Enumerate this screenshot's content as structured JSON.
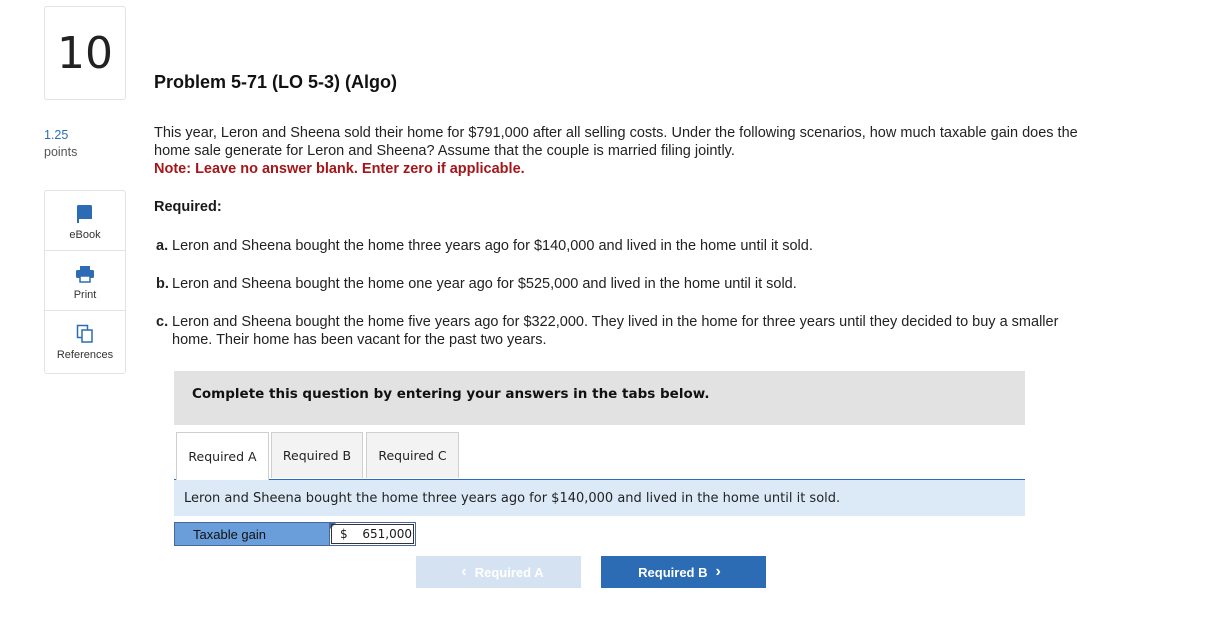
{
  "question": {
    "number": "10",
    "points_value": "1.25",
    "points_label": "points",
    "title": "Problem 5-71 (LO 5-3) (Algo)",
    "intro": "This year, Leron and Sheena sold their home for $791,000 after all selling costs. Under the following scenarios, how much taxable gain does the home sale generate for Leron and Sheena? Assume that the couple is married filing jointly.",
    "note": "Note: Leave no answer blank. Enter zero if applicable.",
    "required_heading": "Required:",
    "items": [
      {
        "letter": "a.",
        "text": "Leron and Sheena bought the home three years ago for $140,000 and lived in the home until it sold."
      },
      {
        "letter": "b.",
        "text": "Leron and Sheena bought the home one year ago for $525,000 and lived in the home until it sold."
      },
      {
        "letter": "c.",
        "text": "Leron and Sheena bought the home five years ago for $322,000. They lived in the home for three years until they decided to buy a smaller home. Their home has been vacant for the past two years."
      }
    ]
  },
  "tools": [
    {
      "label": "eBook",
      "icon": "book-icon"
    },
    {
      "label": "Print",
      "icon": "printer-icon"
    },
    {
      "label": "References",
      "icon": "copy-icon"
    }
  ],
  "panel": {
    "instruction": "Complete this question by entering your answers in the tabs below."
  },
  "tabs": [
    {
      "label": "Required A",
      "active": true
    },
    {
      "label": "Required B",
      "active": false
    },
    {
      "label": "Required C",
      "active": false
    }
  ],
  "active_tab": {
    "question_text": "Leron and Sheena bought the home three years ago for $140,000 and lived in the home until it sold.",
    "answer_label": "Taxable gain",
    "currency": "$",
    "answer_value": "651,000"
  },
  "navigation": {
    "prev_label": "Required A",
    "next_label": "Required B"
  },
  "colors": {
    "accent": "#2b6cb5",
    "note_red": "#a4161a",
    "answer_label_bg": "#6a9edb",
    "question_row_bg": "#dceaf7"
  }
}
